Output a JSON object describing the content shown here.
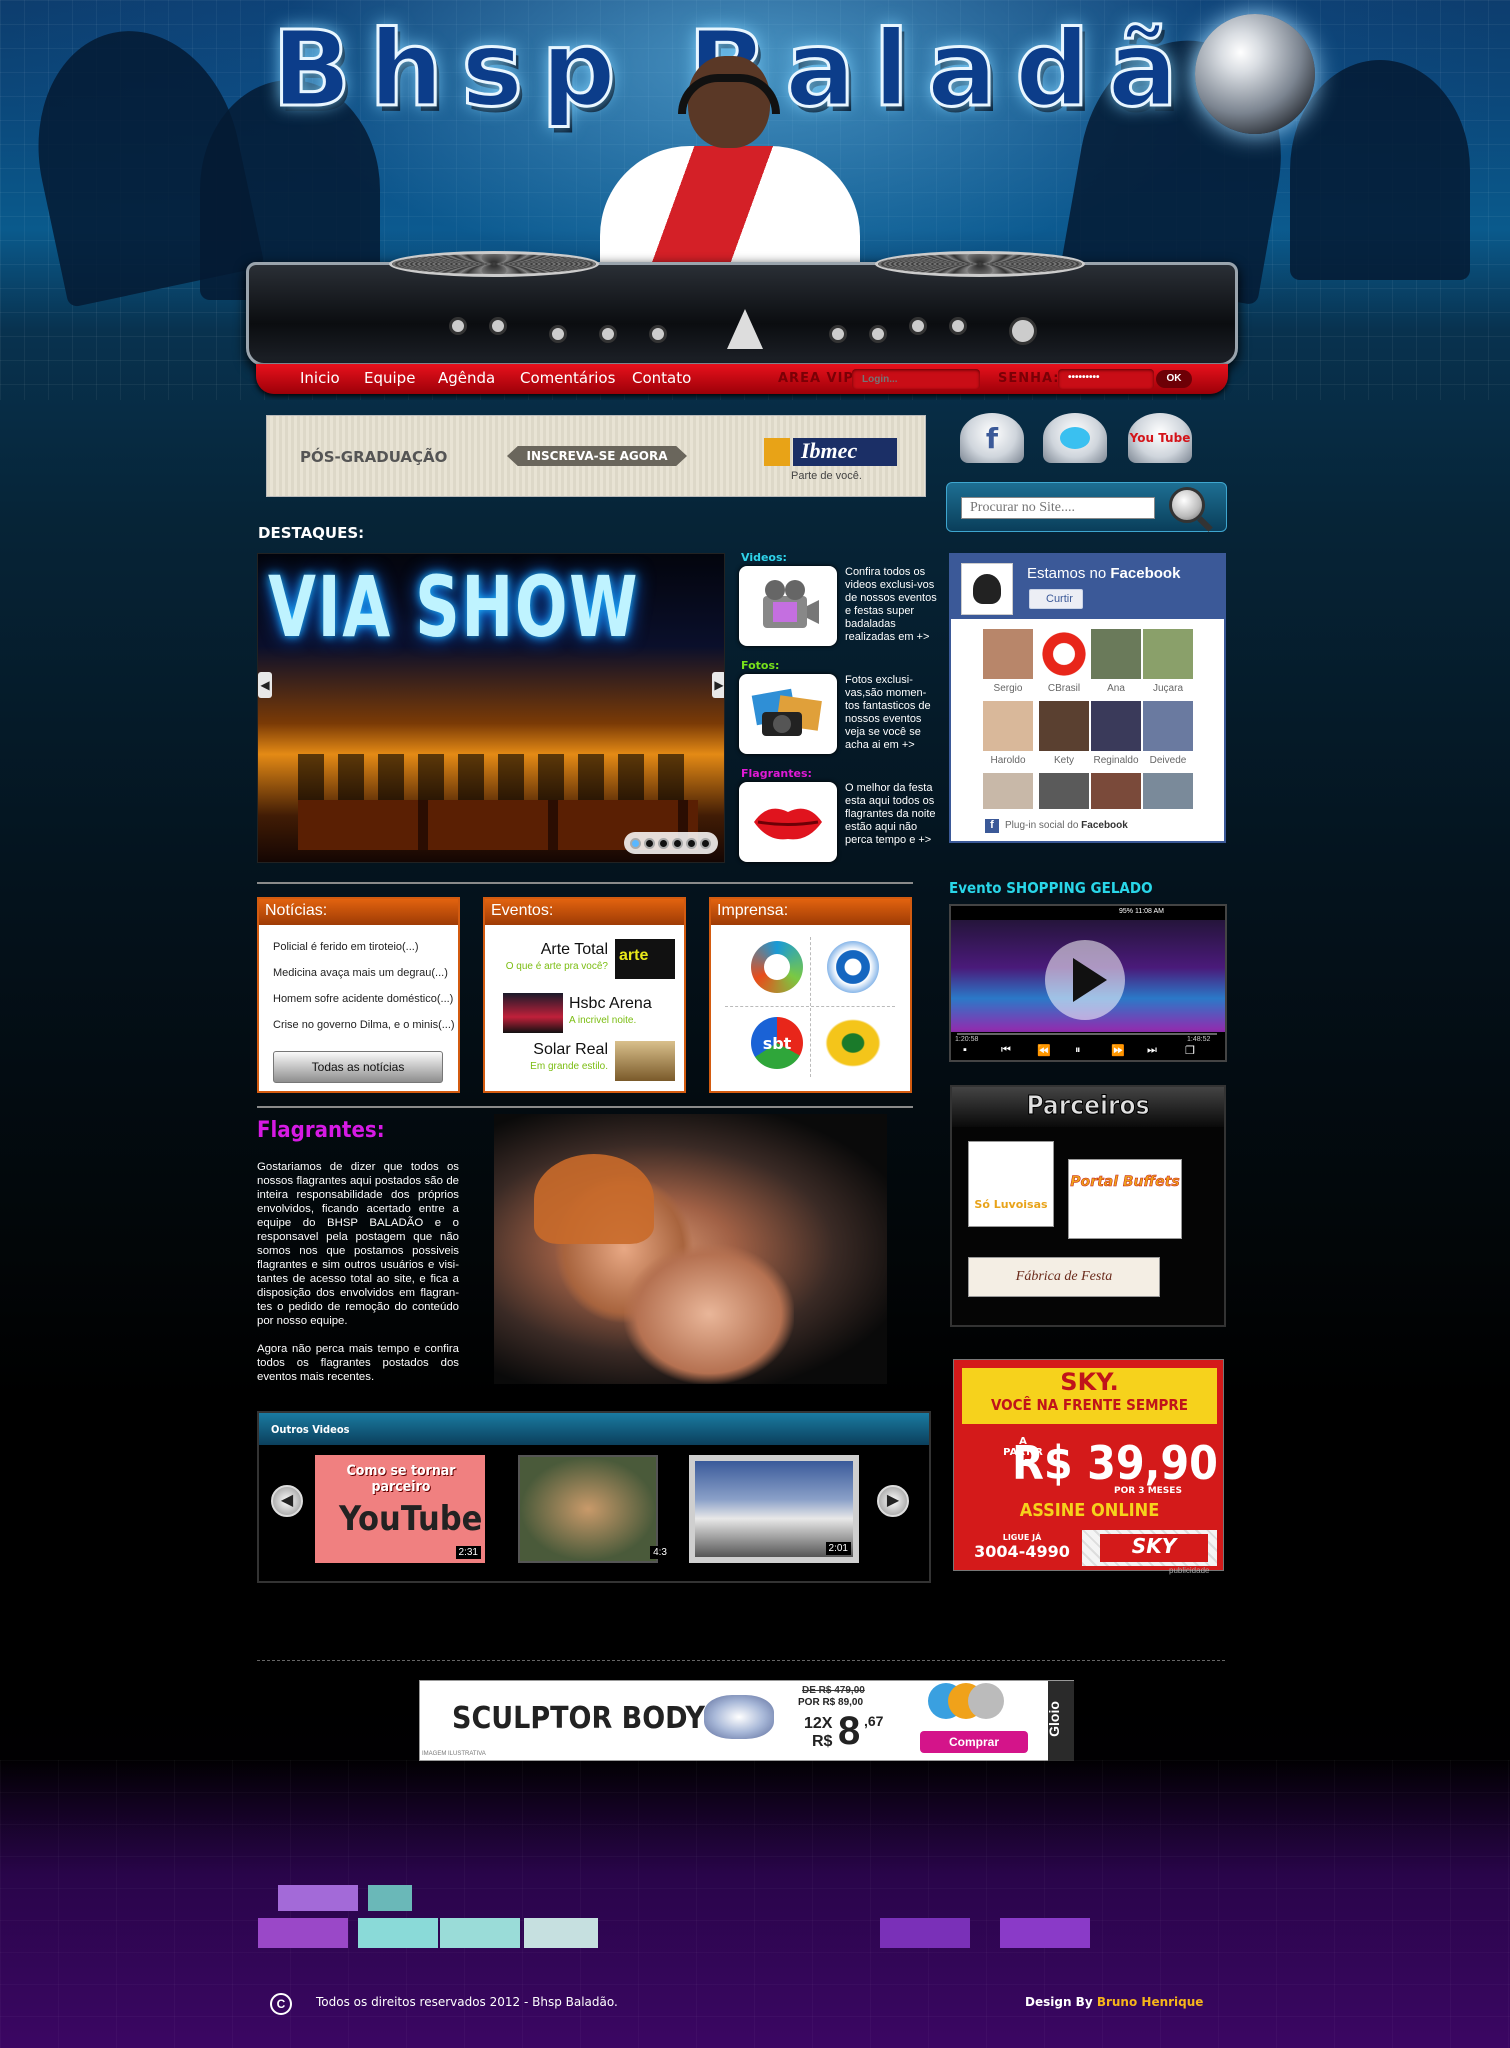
{
  "header": {
    "logo": "Bhsp Baladão",
    "nav": [
      "Inicio",
      "Equipe",
      "Agênda",
      "Comentários",
      "Contato"
    ],
    "vip_label": "AREA VIP:",
    "login_placeholder": "Login...",
    "senha_label": "SENHA:",
    "senha_value": "•••••••••",
    "ok_label": "OK"
  },
  "ibmec_ad": {
    "left": "PÓS-GRADUAÇÃO",
    "cta": "INSCREVA-SE AGORA",
    "brand": "Ibmec",
    "tagline": "Parte de você."
  },
  "destaques": {
    "title": "DESTAQUES:",
    "slide_text": "VIA SHOW",
    "items": [
      {
        "label": "Videos:",
        "text": "Confira todos os videos exclusi-vos de nossos eventos e festas super badaladas realizadas em +>"
      },
      {
        "label": "Fotos:",
        "text": "Fotos exclusi-vas,são momen-tos fantasticos de nossos eventos veja se você se acha ai em +>"
      },
      {
        "label": "Flagrantes:",
        "text": "O melhor da festa esta aqui todos os flagrantes da noite estão aqui não perca tempo e +>"
      }
    ]
  },
  "noticias": {
    "title": "Notícias:",
    "items": [
      "Policial é ferido em tiroteio(...)",
      "Medicina avaça mais um degrau(...)",
      "Homem sofre acidente doméstico(...)",
      "Crise no governo Dilma, e o minis(...)"
    ],
    "button": "Todas as notícias"
  },
  "eventos": {
    "title": "Eventos:",
    "items": [
      {
        "title": "Arte Total",
        "sub": "O que é arte pra você?"
      },
      {
        "title": "Hsbc Arena",
        "sub": "A incrivel noite."
      },
      {
        "title": "Solar Real",
        "sub": "Em grande estilo."
      }
    ]
  },
  "imprensa": {
    "title": "Imprensa:",
    "logos": [
      "sbt"
    ]
  },
  "flagrantes": {
    "title": "Flagrantes:",
    "p1": "Gostariamos de dizer que todos os nossos flagrantes aqui postados são de inteira responsabilidade dos próprios envolvidos, ficando acertado entre a equipe do BHSP BALADÃO e o responsavel pela postagem que não somos nos que postamos possiveis flagrantes e sim outros usuários e visi-tantes de acesso total ao site, e fica a disposição dos envolvidos em flagran-tes o pedido de remoção do conteúdo por nosso equipe.",
    "p2": "Agora não perca mais tempo e confira todos os flagrantes postados dos eventos mais recentes."
  },
  "outros_videos": {
    "title": "Outros Videos",
    "videos": [
      {
        "title": "Como se tornar parceiro",
        "brand": "YouTube",
        "duration": "2:31"
      },
      {
        "duration": "4:3"
      },
      {
        "duration": "2:01"
      }
    ]
  },
  "sidebar": {
    "social": [
      "f",
      "t",
      "You Tube"
    ],
    "search_placeholder": "Procurar no Site....",
    "facebook": {
      "prefix": "Estamos no",
      "brand": "Facebook",
      "like": "Curtir",
      "fans": [
        "Sergio",
        "CBrasil",
        "Ana",
        "Juçara",
        "Haroldo",
        "Kety",
        "Reginaldo",
        "Deivede",
        "",
        "",
        "",
        ""
      ],
      "footer_prefix": "Plug-in social do",
      "footer_brand": "Facebook"
    },
    "evento_title": "Evento SHOPPING GELADO",
    "video_status": "95% 11:08 AM",
    "video_time_left": "1:20:58",
    "video_time_right": "1:48:52",
    "parceiros_title": "Parceiros",
    "parceiros": [
      "Só Luvoisas",
      "Portal Buffets",
      "Fábrica de Festa"
    ]
  },
  "sky_ad": {
    "brand": "SKY.",
    "slogan": "VOCÊ NA FRENTE SEMPRE",
    "from": "A PARTIR DE",
    "price": "R$ 39,90",
    "months": "POR 3 MESES",
    "cta": "ASSINE ONLINE",
    "phone_label": "LIGUE JÁ",
    "phone": "3004-4990",
    "logo": "SKY",
    "footer": "publicidade"
  },
  "sculptor_ad": {
    "title": "SCULPTOR BODY",
    "old_price": "DE R$ 479,00",
    "new_price": "POR R$ 89,00",
    "installments": "12X",
    "currency": "R$",
    "value": "8",
    "cents": ",67",
    "button": "Comprar",
    "brand": "Gloio",
    "note": "IMAGEM ILUSTRATIVA"
  },
  "footer": {
    "copyright": "Todos os direitos reservados 2012 - Bhsp Baladão.",
    "design_prefix": "Design By",
    "designer": "Bruno Henrique"
  }
}
